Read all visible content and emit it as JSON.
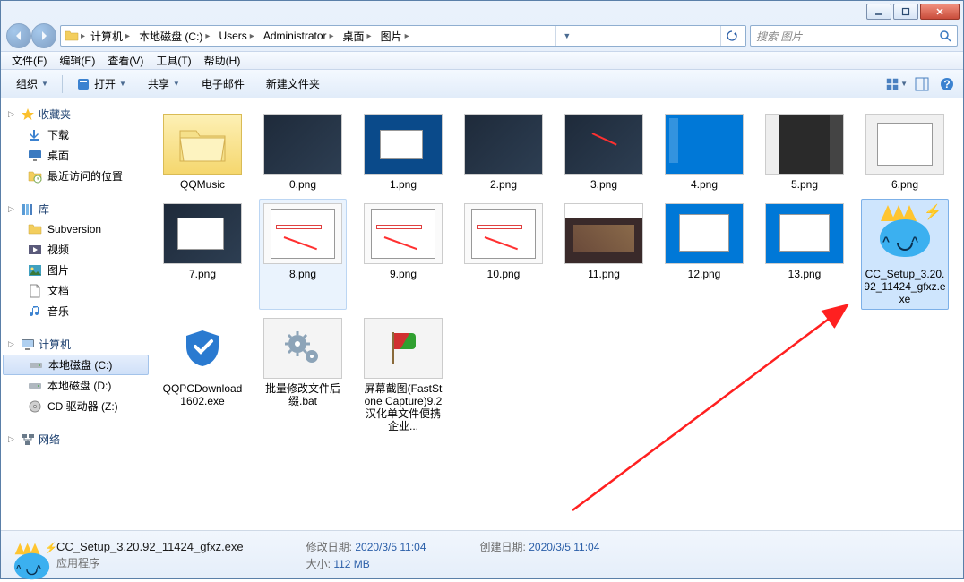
{
  "window": {
    "title": ""
  },
  "breadcrumbs": [
    "计算机",
    "本地磁盘 (C:)",
    "Users",
    "Administrator",
    "桌面",
    "图片"
  ],
  "search": {
    "placeholder": "搜索 图片"
  },
  "menu": {
    "file": "文件(F)",
    "edit": "编辑(E)",
    "view": "查看(V)",
    "tools": "工具(T)",
    "help": "帮助(H)"
  },
  "toolbar": {
    "organize": "组织",
    "open": "打开",
    "share": "共享",
    "email": "电子邮件",
    "new_folder": "新建文件夹"
  },
  "sidebar": {
    "favorites": {
      "label": "收藏夹",
      "items": [
        "下载",
        "桌面",
        "最近访问的位置"
      ]
    },
    "libraries": {
      "label": "库",
      "items": [
        "Subversion",
        "视频",
        "图片",
        "文档",
        "音乐"
      ]
    },
    "computer": {
      "label": "计算机",
      "items": [
        "本地磁盘 (C:)",
        "本地磁盘 (D:)",
        "CD 驱动器 (Z:)"
      ]
    },
    "network": {
      "label": "网络"
    }
  },
  "items": {
    "r1": [
      {
        "name": "QQMusic",
        "type": "folder"
      },
      {
        "name": "0.png",
        "type": "img-dark"
      },
      {
        "name": "1.png",
        "type": "img-blue-win"
      },
      {
        "name": "2.png",
        "type": "img-dark"
      },
      {
        "name": "3.png",
        "type": "img-dark-red"
      },
      {
        "name": "4.png",
        "type": "img-deskblue"
      },
      {
        "name": "5.png",
        "type": "img-app"
      },
      {
        "name": "6.png",
        "type": "img-light-win"
      }
    ],
    "r2": [
      {
        "name": "7.png",
        "type": "img-dark-win"
      },
      {
        "name": "8.png",
        "type": "img-light-red",
        "hovered": true
      },
      {
        "name": "9.png",
        "type": "img-light-red"
      },
      {
        "name": "10.png",
        "type": "img-light-red"
      },
      {
        "name": "11.png",
        "type": "img-game"
      },
      {
        "name": "12.png",
        "type": "img-deskblue-win"
      },
      {
        "name": "13.png",
        "type": "img-deskblue-win"
      },
      {
        "name": "CC_Setup_3.20.92_11424_gfxz.exe",
        "type": "cc-exe",
        "selected": true
      }
    ],
    "r3": [
      {
        "name": "QQPCDownload1602.exe",
        "type": "qq-exe"
      },
      {
        "name": "批量修改文件后缀.bat",
        "type": "bat"
      },
      {
        "name": "屏幕截图(FastStone Capture)9.2汉化单文件便携企业...",
        "type": "flag-exe"
      }
    ]
  },
  "details": {
    "filename": "CC_Setup_3.20.92_11424_gfxz.exe",
    "filetype": "应用程序",
    "mod_label": "修改日期:",
    "mod_value": "2020/3/5 11:04",
    "size_label": "大小:",
    "size_value": "112 MB",
    "create_label": "创建日期:",
    "create_value": "2020/3/5 11:04"
  }
}
